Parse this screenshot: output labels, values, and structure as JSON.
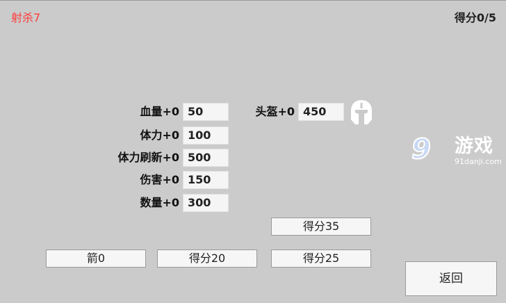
{
  "header": {
    "kills_label": "射杀7",
    "score_label": "得分0/5"
  },
  "stats": {
    "hp_label": "血量+0",
    "hp_value": "50",
    "stamina_label": "体力+0",
    "stamina_value": "100",
    "stamina_refresh_label": "体力刷新+0",
    "stamina_refresh_value": "500",
    "damage_label": "伤害+0",
    "damage_value": "150",
    "quantity_label": "数量+0",
    "quantity_value": "300",
    "helmet_label": "头盔+0",
    "helmet_value": "450"
  },
  "buttons": {
    "arrow": "箭0",
    "score20": "得分20",
    "score25": "得分25",
    "score35": "得分35",
    "back": "返回"
  },
  "watermark": {
    "number": "9",
    "name": "游戏",
    "url": "91danji.com"
  },
  "icons": {
    "helmet": "helmet-icon"
  },
  "colors": {
    "background": "#cbcbcb",
    "kills_text": "#ff3a3a"
  }
}
